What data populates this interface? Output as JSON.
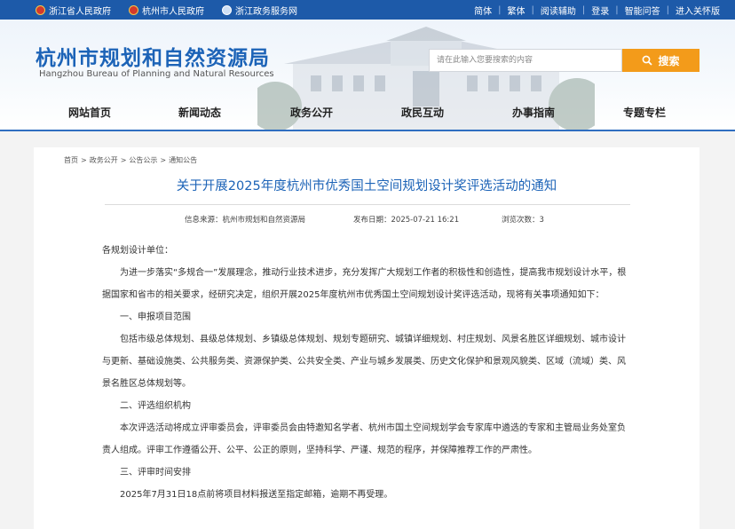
{
  "topbar": {
    "links": [
      "浙江省人民政府",
      "杭州市人民政府",
      "浙江政务服务网"
    ],
    "right_items": [
      "简体",
      "繁体",
      "阅读辅助",
      "登录",
      "智能问答",
      "进入关怀版"
    ]
  },
  "header": {
    "title_cn": "杭州市规划和自然资源局",
    "title_en": "Hangzhou Bureau of Planning and Natural Resources",
    "search_placeholder": "请在此输入您要搜索的内容",
    "search_button": "搜索"
  },
  "nav": [
    "网站首页",
    "新闻动态",
    "政务公开",
    "政民互动",
    "办事指南",
    "专题专栏"
  ],
  "breadcrumb": [
    "首页",
    "政务公开",
    "公告公示",
    "通知公告"
  ],
  "article": {
    "title": "关于开展2025年度杭州市优秀国土空间规划设计奖评选活动的通知",
    "source": "信息来源：杭州市规划和自然资源局",
    "date": "发布日期：2025-07-21 16:21",
    "views": "浏览次数：3",
    "paragraphs": [
      "各规划设计单位：",
      "为进一步落实“多规合一”发展理念，推动行业技术进步，充分发挥广大规划工作者的积极性和创造性，提高我市规划设计水平，根据国家和省市的相关要求，经研究决定，组织开展2025年度杭州市优秀国土空间规划设计奖评选活动，现将有关事项通知如下：",
      "一、申报项目范围",
      "包括市级总体规划、县级总体规划、乡镇级总体规划、规划专题研究、城镇详细规划、村庄规划、风景名胜区详细规划、城市设计与更新、基础设施类、公共服务类、资源保护类、公共安全类、产业与城乡发展类、历史文化保护和景观风貌类、区域（流域）类、风景名胜区总体规划等。",
      "二、评选组织机构",
      "本次评选活动将成立评审委员会，评审委员会由特邀知名学者、杭州市国土空间规划学会专家库中遴选的专家和主管局业务处室负责人组成。评审工作遵循公开、公平、公正的原则，坚持科学、严谨、规范的程序，并保障推荐工作的严肃性。",
      "三、评审时间安排",
      "2025年7月31日18点前将项目材料报送至指定邮箱，逾期不再受理。"
    ]
  },
  "colors": {
    "topbar": "#1d5aa9",
    "title": "#1c63b7",
    "search_button": "#f39b1a"
  },
  "icons": [
    "government-emblem-icon",
    "government-emblem-icon",
    "globe-icon",
    "search-icon"
  ]
}
